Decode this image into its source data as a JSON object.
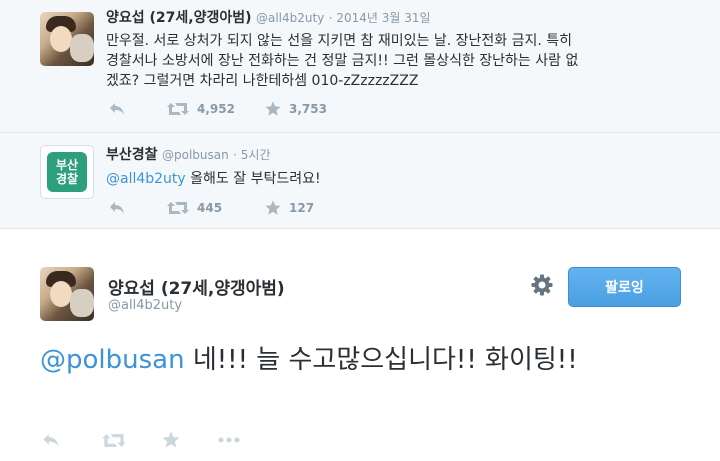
{
  "tweets": [
    {
      "name": "양요섭 (27세,양갱아범)",
      "handle": "@all4b2uty",
      "time": "· 2014년 3월 31일",
      "lines": [
        "만우절. 서로 상처가 되지 않는 선을 지키면 참 재미있는 날. 장난전화 금지. 특히",
        "경찰서나 소방서에 장난 전화하는 건 정말 금지!! 그런 몰상식한 장난하는 사람 없",
        "겠죠? 그럴거면 차라리 나한테하셈 010-zZzzzzZZZ"
      ],
      "retweets": "4,952",
      "favorites": "3,753"
    },
    {
      "name": "부산경찰",
      "handle": "@polbusan",
      "time": "· 5시간",
      "mention": "@all4b2uty",
      "text": " 올해도 잘 부탁드려요!",
      "retweets": "445",
      "favorites": "127",
      "logo_line1": "부산",
      "logo_line2": "경찰"
    }
  ],
  "main": {
    "name": "양요섭 (27세,양갱아범)",
    "handle": "@all4b2uty",
    "follow_label": "팔로잉",
    "mention": "@polbusan",
    "text": " 네!!! 늘 수고많으십니다!! 화이팅!!"
  },
  "icons": {
    "reply": "reply-icon",
    "retweet": "retweet-icon",
    "favorite": "star-icon",
    "more": "more-icon",
    "settings": "gear-icon"
  },
  "colors": {
    "link": "#3b94d9",
    "button": "#55acee",
    "muted": "#8899a6",
    "police_green": "#2e9f7e"
  }
}
